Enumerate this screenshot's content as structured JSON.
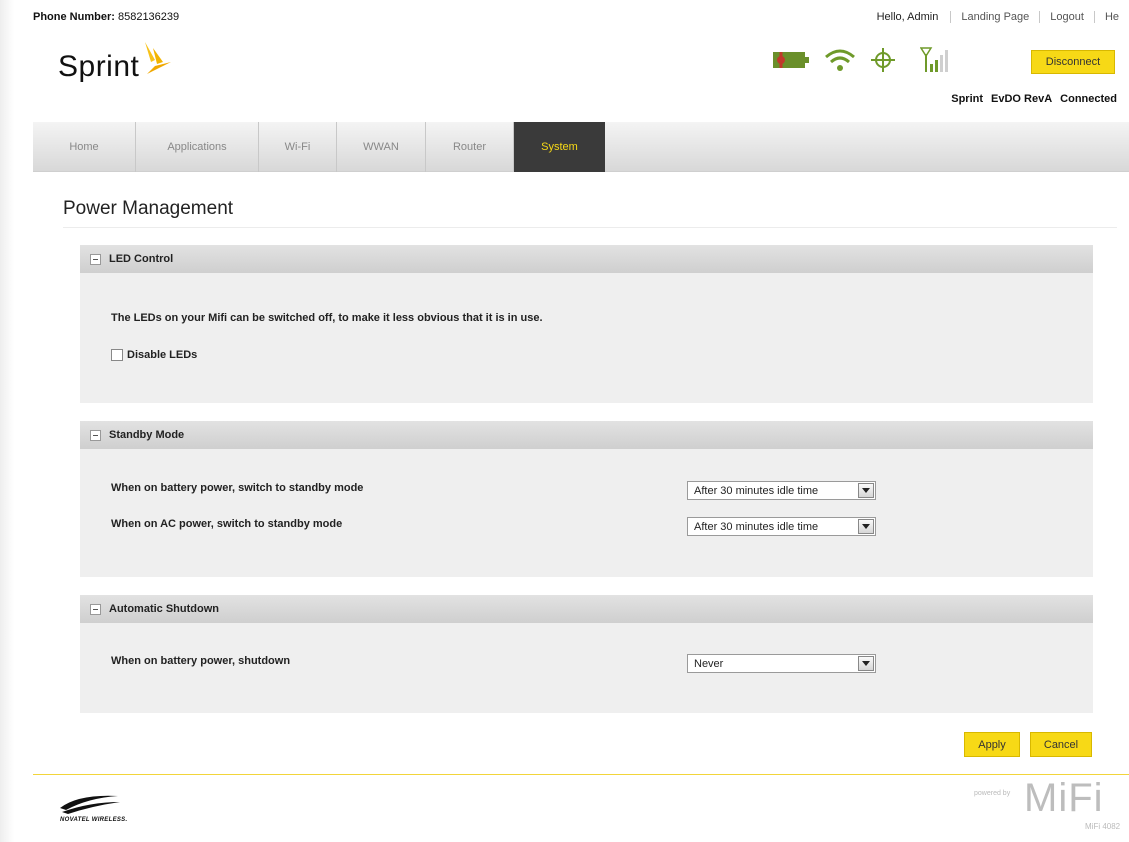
{
  "header": {
    "phone_label": "Phone Number:",
    "phone_value": "8582136239",
    "greeting": "Hello, Admin",
    "links": [
      "Landing Page",
      "Logout",
      "He"
    ],
    "brand": "Sprint",
    "disconnect_label": "Disconnect",
    "status": {
      "carrier": "Sprint",
      "network": "EvDO RevA",
      "state": "Connected"
    }
  },
  "nav": {
    "tabs": [
      "Home",
      "Applications",
      "Wi-Fi",
      "WWAN",
      "Router",
      "System"
    ],
    "active": "System"
  },
  "page": {
    "title": "Power Management"
  },
  "led_control": {
    "title": "LED Control",
    "description": "The LEDs on your Mifi can be switched off, to make it less obvious that it is in use.",
    "checkbox_label": "Disable LEDs",
    "checked": false
  },
  "standby": {
    "title": "Standby Mode",
    "battery_label": "When on battery power, switch to standby mode",
    "battery_value": "After 30 minutes idle time",
    "ac_label": "When on AC power, switch to standby mode",
    "ac_value": "After 30 minutes idle time"
  },
  "shutdown": {
    "title": "Automatic Shutdown",
    "battery_label": "When on battery power, shutdown",
    "battery_value": "Never"
  },
  "actions": {
    "apply": "Apply",
    "cancel": "Cancel"
  },
  "footer": {
    "vendor": "NOVATEL WIRELESS.",
    "powered_by": "powered by",
    "product": "MiFi",
    "model": "MiFi 4082"
  },
  "colors": {
    "accent": "#f7d916",
    "battery": "#6a8f2a",
    "icon_green": "#6f9a2a"
  }
}
